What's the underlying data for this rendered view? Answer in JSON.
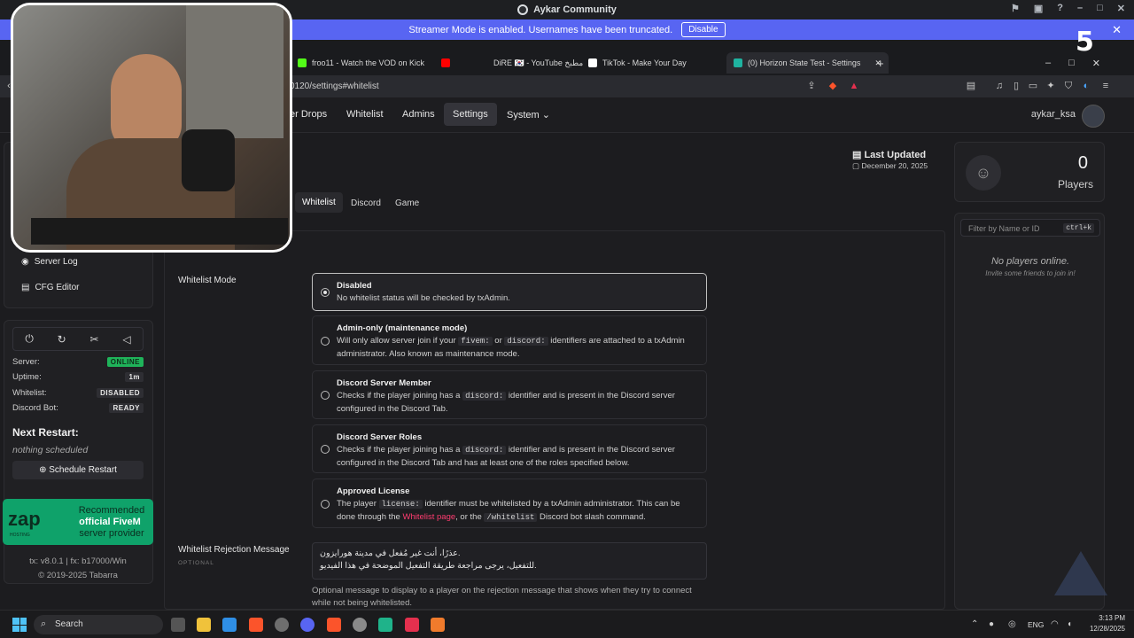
{
  "discord": {
    "title": "Aykar Community",
    "streamer_text": "Streamer Mode is enabled. Usernames have been truncated.",
    "streamer_button": "Disable"
  },
  "browser": {
    "tabs": [
      {
        "label": "froo11 - Watch the VOD on Kick",
        "color": "#53fc18"
      },
      {
        "label": "",
        "color": "#ff0000"
      },
      {
        "label": "DiRE 🇰🇷 - YouTube مطبخ",
        "color": "#ff0000"
      },
      {
        "label": "TikTok - Make Your Day",
        "color": "#ffffff"
      },
      {
        "label": "(0) Horizon State Test - Settings",
        "color": "#1fb3a0"
      }
    ],
    "url": "0120/settings#whitelist",
    "new_tab": "+"
  },
  "nav": {
    "links": [
      "er Drops",
      "Whitelist",
      "Admins",
      "Settings",
      "System ⌄"
    ],
    "user": "aykar_ksa"
  },
  "last_updated": {
    "label": "Last Updated",
    "date": "December 20, 2025"
  },
  "subtabs": [
    "Whitelist",
    "Discord",
    "Game"
  ],
  "sidebar": {
    "menu": [
      "Server Log",
      "CFG Editor"
    ],
    "status": [
      {
        "label": "Server:",
        "value": "ONLINE"
      },
      {
        "label": "Uptime:",
        "value": "1m"
      },
      {
        "label": "Whitelist:",
        "value": "DISABLED"
      },
      {
        "label": "Discord Bot:",
        "value": "READY"
      }
    ],
    "next_restart_title": "Next Restart:",
    "next_restart_value": "nothing scheduled",
    "schedule_button": "⊕ Schedule Restart",
    "ad": {
      "brand": "zap",
      "brand_sub": "HOSTING",
      "line1": "Recommended",
      "line2": "official FiveM",
      "line3": "server provider"
    },
    "version": "tx: v8.0.1 | fx: b17000/Win",
    "copyright": "© 2019-2025 Tabarra"
  },
  "whitelist": {
    "mode_label": "Whitelist Mode",
    "options": [
      {
        "title": "Disabled",
        "desc": "No whitelist status will be checked by txAdmin."
      },
      {
        "title": "Admin-only (maintenance mode)",
        "desc_a": "Will only allow server join if your ",
        "code1": "fivem:",
        "desc_b": " or ",
        "code2": "discord:",
        "desc_c": " identifiers are attached to a txAdmin administrator. Also known as maintenance mode."
      },
      {
        "title": "Discord Server Member",
        "desc_a": "Checks if the player joining has a ",
        "code1": "discord:",
        "desc_b": " identifier and is present in the Discord server configured in the Discord Tab."
      },
      {
        "title": "Discord Server Roles",
        "desc_a": "Checks if the player joining has a ",
        "code1": "discord:",
        "desc_b": " identifier and is present in the Discord server configured in the Discord Tab and has at least one of the roles specified below."
      },
      {
        "title": "Approved License",
        "desc_a": "The player ",
        "code1": "license:",
        "desc_b": " identifier must be whitelisted by a txAdmin administrator. This can be done through the ",
        "link": "Whitelist page",
        "desc_c": ", or the ",
        "code2": "/whitelist",
        "desc_d": " Discord bot slash command."
      }
    ],
    "rejection_label": "Whitelist Rejection Message",
    "optional": "OPTIONAL",
    "rejection_line1": "عذرًا، أنت غير مُفعل في مدينة هورايزون.",
    "rejection_line2": "للتفعيل، يرجى مراجعة طريقة التفعيل الموضحة في هذا الفيديو.",
    "rejection_help": "Optional message to display to a player on the rejection message that shows when they try to connect while not being whitelisted."
  },
  "players": {
    "count": "0",
    "label": "Players",
    "filter_placeholder": "Filter by Name or ID",
    "shortcut": "ctrl+k",
    "empty_title": "No players online.",
    "empty_sub": "Invite some friends to join in!"
  },
  "taskbar": {
    "search": "Search",
    "lang": "ENG",
    "time": "3:13 PM",
    "date": "12/28/2025"
  },
  "overlay": {
    "five": "5"
  }
}
